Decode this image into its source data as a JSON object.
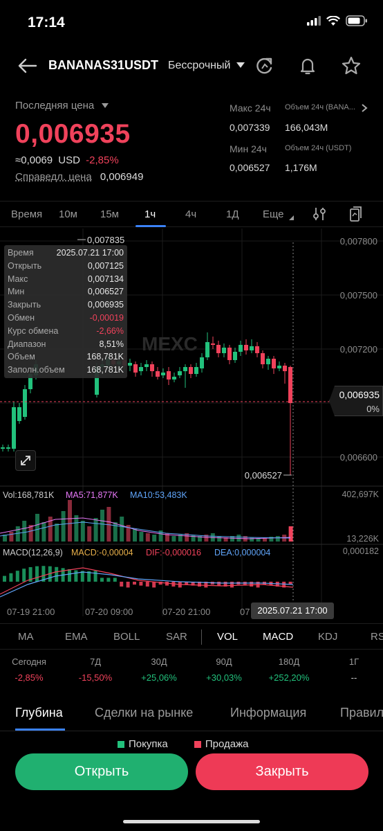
{
  "status": {
    "time": "17:14"
  },
  "header": {
    "symbol": "BANANAS31USDT",
    "contract_type": "Бессрочный"
  },
  "ticker": {
    "last_price_label": "Последняя цена",
    "last_price": "0,006935",
    "approx_value": "≈0,0069",
    "approx_currency": "USD",
    "change_pct": "-2,85%",
    "fair_price_label": "Справедл. цена",
    "fair_price": "0,006949"
  },
  "stats": {
    "high_label": "Макс 24ч",
    "high": "0,007339",
    "vol_base_label": "Объем 24ч (BANA...",
    "vol_base": "166,043M",
    "low_label": "Мин 24ч",
    "low": "0,006527",
    "vol_quote_label": "Объем 24ч  (USDT)",
    "vol_quote": "1,176M"
  },
  "timeframes": [
    "Время",
    "10м",
    "15м",
    "1ч",
    "4ч",
    "1Д",
    "Еще"
  ],
  "active_timeframe": "1ч",
  "chart": {
    "price_axis": [
      "0,007800",
      "0,007500",
      "0,007200",
      "0,006600"
    ],
    "high_marker": "0,007835",
    "low_marker": "0,006527",
    "current_price": "0,006935",
    "current_pct": "0%",
    "watermark": "MEXC",
    "vol_legend": {
      "vol": "Vol:168,781K",
      "ma5": "MA5:71,877K",
      "ma10": "MA10:53,483K"
    },
    "vol_axis": {
      "top": "402,697K",
      "bottom": "13,226K"
    },
    "macd_legend": {
      "macd_name": "MACD(12,26,9)",
      "macd": "MACD:-0,00004",
      "dif": "DIF:-0,000016",
      "dea": "DEA:0,000004"
    },
    "macd_axis": "0,000182",
    "time_axis": [
      "07-19 21:00",
      "07-20 09:00",
      "07-20 21:00",
      "07"
    ],
    "crosshair_time": "2025.07.21 17:00",
    "colors": {
      "up": "#22c17c",
      "down": "#f0425b",
      "ma5": "#e879f9",
      "ma10": "#60a5fa",
      "dif": "#f0425b",
      "dea": "#60a5fa"
    }
  },
  "tooltip": [
    {
      "k": "Время",
      "v": "2025.07.21 17:00"
    },
    {
      "k": "Открыть",
      "v": "0,007125"
    },
    {
      "k": "Макс",
      "v": "0,007134"
    },
    {
      "k": "Мин",
      "v": "0,006527"
    },
    {
      "k": "Закрыть",
      "v": "0,006935"
    },
    {
      "k": "Обмен",
      "v": "-0,00019",
      "neg": true
    },
    {
      "k": "Курс обмена",
      "v": "-2,66%",
      "neg": true
    },
    {
      "k": "Диапазон",
      "v": "8,51%"
    },
    {
      "k": "Объем",
      "v": "168,781K"
    },
    {
      "k": "Заполн.объем",
      "v": "168,781K"
    }
  ],
  "indicators": [
    "MA",
    "EMA",
    "BOLL",
    "SAR",
    "VOL",
    "MACD",
    "KDJ",
    "RSI"
  ],
  "performance": [
    {
      "label": "Сегодня",
      "value": "-2,85%",
      "dir": "neg"
    },
    {
      "label": "7Д",
      "value": "-15,50%",
      "dir": "neg"
    },
    {
      "label": "30Д",
      "value": "+25,06%",
      "dir": "pos"
    },
    {
      "label": "90Д",
      "value": "+30,03%",
      "dir": "pos"
    },
    {
      "label": "180Д",
      "value": "+252,20%",
      "dir": "pos"
    },
    {
      "label": "1Г",
      "value": "--",
      "dir": "neu"
    }
  ],
  "tabs": [
    "Глубина",
    "Сделки на рынке",
    "Информация",
    "Правил"
  ],
  "legend": {
    "buy": "Покупка",
    "sell": "Продажа"
  },
  "actions": {
    "open": "Открыть",
    "close": "Закрыть"
  }
}
